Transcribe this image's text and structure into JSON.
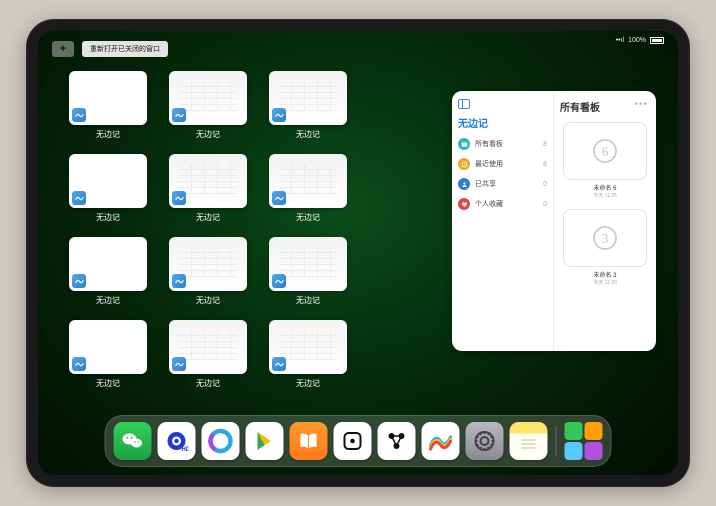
{
  "status": {
    "signal": "•ıl",
    "wifi": "Wi-Fi",
    "battery": "100%"
  },
  "top": {
    "plus": "+",
    "reopen_label": "重新打开已关闭的窗口"
  },
  "grid": {
    "items": [
      {
        "label": "无边记",
        "blank": true
      },
      {
        "label": "无边记",
        "blank": false
      },
      {
        "label": "无边记",
        "blank": false
      },
      {
        "label": "无边记",
        "blank": true
      },
      {
        "label": "无边记",
        "blank": false
      },
      {
        "label": "无边记",
        "blank": false
      },
      {
        "label": "无边记",
        "blank": true
      },
      {
        "label": "无边记",
        "blank": false
      },
      {
        "label": "无边记",
        "blank": false
      },
      {
        "label": "无边记",
        "blank": true
      },
      {
        "label": "无边记",
        "blank": false
      },
      {
        "label": "无边记",
        "blank": false
      }
    ]
  },
  "panel": {
    "left_title": "无边记",
    "right_title": "所有看板",
    "categories": [
      {
        "label": "所有看板",
        "count": 8,
        "color": "#2fb3c9"
      },
      {
        "label": "最近使用",
        "count": 8,
        "color": "#f5a623"
      },
      {
        "label": "已共享",
        "count": 0,
        "color": "#2b7ed0"
      },
      {
        "label": "个人收藏",
        "count": 0,
        "color": "#e8473d"
      }
    ],
    "boards": [
      {
        "name": "未命名 6",
        "time": "今天 11:25",
        "glyph": "6"
      },
      {
        "name": "未命名 3",
        "time": "今天 11:20",
        "glyph": "3"
      }
    ]
  },
  "dock": {
    "apps": [
      {
        "name": "wechat",
        "bg": "linear-gradient(#30d158,#1fa046)"
      },
      {
        "name": "quark",
        "bg": "#fff"
      },
      {
        "name": "browser",
        "bg": "#fff"
      },
      {
        "name": "play",
        "bg": "#fff"
      },
      {
        "name": "books",
        "bg": "linear-gradient(#ff9a2e,#ff7a1a)"
      },
      {
        "name": "dice",
        "bg": "#fff"
      },
      {
        "name": "connect",
        "bg": "#fff"
      },
      {
        "name": "freeform",
        "bg": "#fff"
      },
      {
        "name": "settings",
        "bg": "linear-gradient(#b8b8be,#8a8a92)"
      },
      {
        "name": "notes",
        "bg": "linear-gradient(#ffe36b 0% 30%,#fffef6 30% 100%)"
      }
    ],
    "recent": {
      "name": "app-library"
    }
  }
}
